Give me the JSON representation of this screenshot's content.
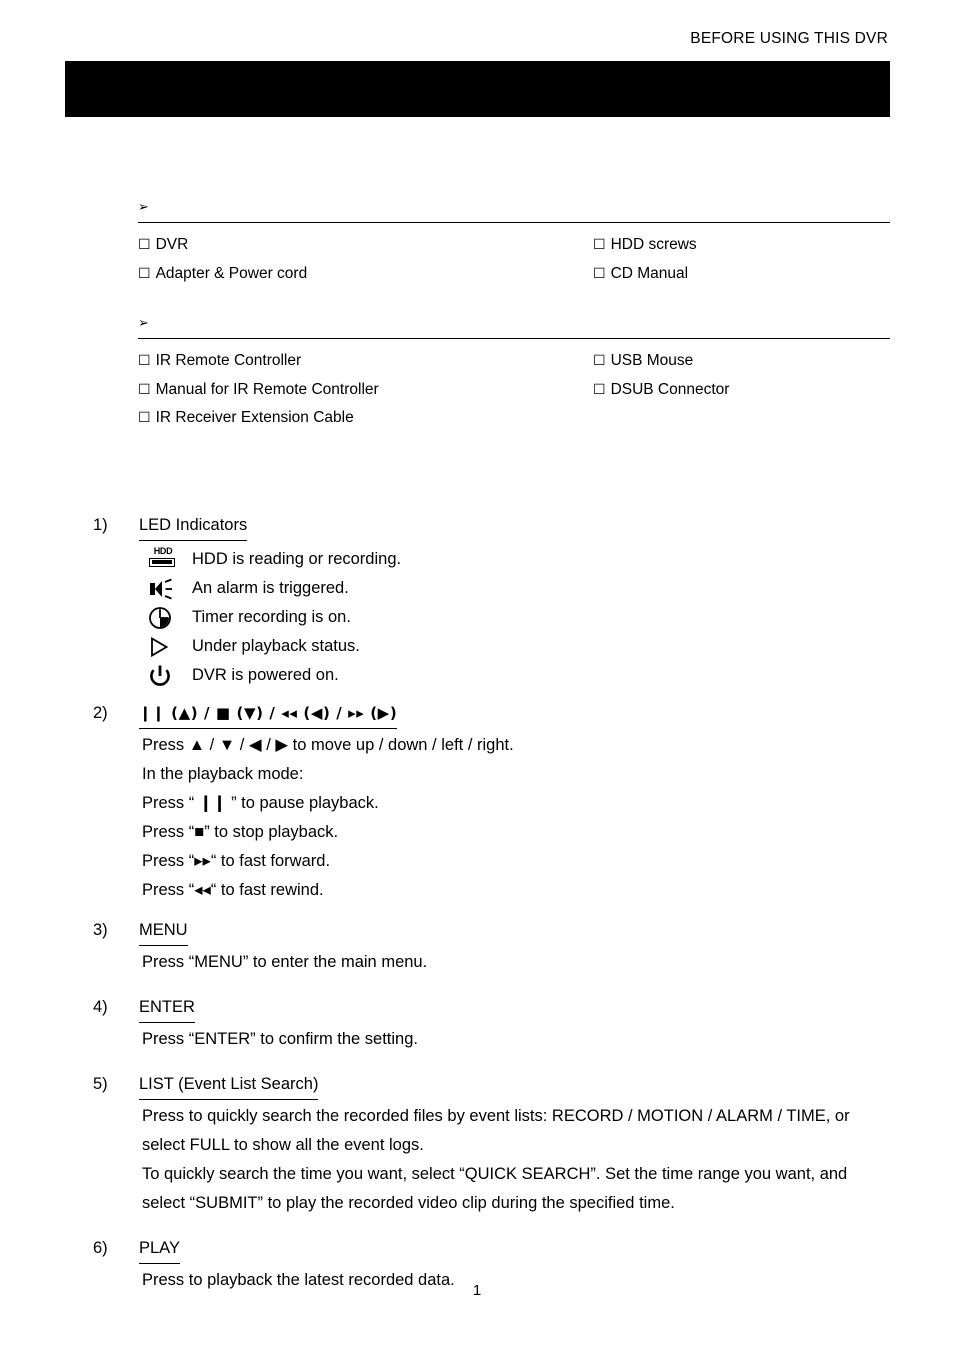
{
  "header": {
    "running_title": "BEFORE USING THIS DVR"
  },
  "title_banner": {
    "text": "",
    "background_color": "#000000"
  },
  "checklists": [
    {
      "id": "package",
      "bullet": "➢",
      "heading": "",
      "columns": {
        "left": [
          {
            "checkbox": "☐",
            "label": "DVR"
          },
          {
            "checkbox": "☐",
            "label": "Adapter & Power cord"
          }
        ],
        "right": [
          {
            "checkbox": "☐",
            "label": "HDD screws"
          },
          {
            "checkbox": "☐",
            "label": "CD Manual"
          }
        ]
      }
    },
    {
      "id": "optional",
      "bullet": "➢",
      "heading": "",
      "columns": {
        "left": [
          {
            "checkbox": "☐",
            "label": "IR Remote Controller"
          },
          {
            "checkbox": "☐",
            "label": "Manual for IR Remote Controller"
          },
          {
            "checkbox": "☐",
            "label": "IR Receiver Extension Cable"
          }
        ],
        "right": [
          {
            "checkbox": "☐",
            "label": "USB Mouse"
          },
          {
            "checkbox": "☐",
            "label": "DSUB Connector"
          }
        ]
      }
    }
  ],
  "sections": [
    {
      "number": "1)",
      "title": "LED Indicators",
      "led_indicators": [
        {
          "icon": "hdd-icon",
          "label": "HDD is reading or recording."
        },
        {
          "icon": "alarm-speaker-icon",
          "label": "An alarm is triggered."
        },
        {
          "icon": "clock-timer-icon",
          "label": "Timer recording is on."
        },
        {
          "icon": "play-triangle-icon",
          "label": "Under playback status."
        },
        {
          "icon": "power-icon",
          "label": "DVR is powered on."
        }
      ]
    },
    {
      "number": "2)",
      "title": "❙❙ (▲) / ■ (▼) / ◂◂ (◀) / ▸▸ (▶)",
      "lines": [
        "Press ▲ / ▼ / ◀ / ▶ to move up / down / left / right.",
        "In the playback mode:",
        "Press “ ❙❙ ” to pause playback.",
        "Press “■” to stop playback.",
        "Press “▸▸“ to fast forward.",
        "Press “◂◂“ to fast rewind."
      ]
    },
    {
      "number": "3)",
      "title": "MENU",
      "lines": [
        "Press “MENU” to enter the main menu."
      ]
    },
    {
      "number": "4)",
      "title": "ENTER",
      "lines": [
        "Press “ENTER” to confirm the setting."
      ]
    },
    {
      "number": "5)",
      "title": "LIST (Event List Search)",
      "lines": [
        "Press to quickly search the recorded files by event lists: RECORD / MOTION / ALARM / TIME, or select FULL to show all the event logs.",
        "To quickly search the time you want, select “QUICK SEARCH”. Set the time range you want, and select “SUBMIT” to play the recorded video clip during the specified time."
      ]
    },
    {
      "number": "6)",
      "title": "PLAY",
      "lines": [
        "Press to playback the latest recorded data."
      ]
    }
  ],
  "footer": {
    "page_number": "1"
  }
}
